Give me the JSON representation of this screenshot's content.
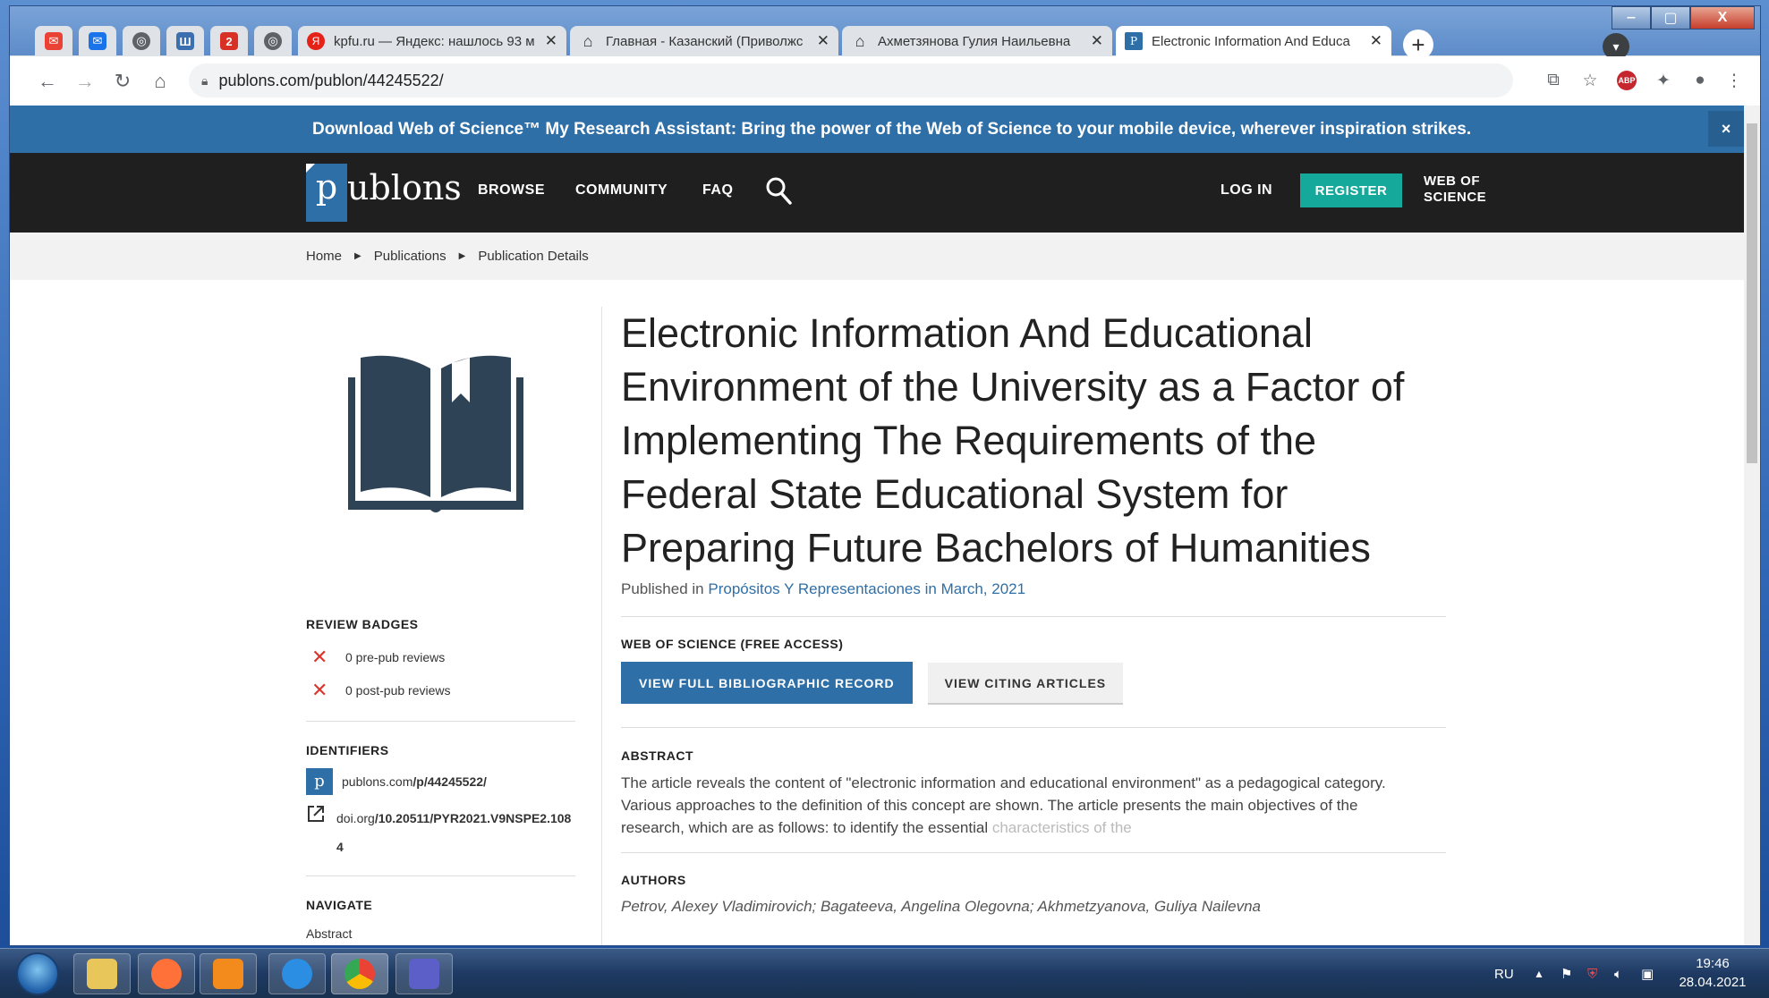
{
  "browser": {
    "pinned_tabs": [
      {
        "icon": "gmail-icon",
        "color": "#ea4335",
        "glyph": "✉"
      },
      {
        "icon": "mail-icon",
        "color": "#1a73e8",
        "glyph": "✉"
      },
      {
        "icon": "globe-icon",
        "color": "#5f6368",
        "glyph": "◎"
      },
      {
        "icon": "bookmark-app-icon",
        "color": "#3c6fb0",
        "glyph": "Ш"
      },
      {
        "icon": "app-icon",
        "color": "#d93025",
        "glyph": "2"
      },
      {
        "icon": "globe-icon",
        "color": "#5f6368",
        "glyph": "◎"
      }
    ],
    "tabs": [
      {
        "title": "kpfu.ru — Яндекс: нашлось 93 м",
        "fav_color": "#e62117",
        "fav_glyph": "Я"
      },
      {
        "title": "Главная - Казанский (Приволжс",
        "fav_color": "#5f6368",
        "fav_glyph": "⌂"
      },
      {
        "title": "Ахметзянова Гулия Наильевна",
        "fav_color": "#5f6368",
        "fav_glyph": "⌂"
      },
      {
        "title": "Electronic Information And Educa",
        "fav_color": "#2f6fa7",
        "fav_glyph": "P",
        "active": true
      }
    ],
    "new_tab_label": "+",
    "url": "publons.com/publon/44245522/",
    "window_buttons": [
      "‒",
      "▢",
      "X"
    ]
  },
  "banner": {
    "text": "Download Web of Science™ My Research Assistant: Bring the power of the Web of Science to your mobile device, wherever inspiration strikes.",
    "close": "×"
  },
  "nav": {
    "logo_p": "p",
    "logo_rest": "ublons",
    "browse": "BROWSE",
    "community": "COMMUNITY",
    "faq": "FAQ",
    "login": "LOG IN",
    "register": "REGISTER",
    "wos_line1": "WEB OF",
    "wos_line2": "SCIENCE"
  },
  "breadcrumb": [
    "Home",
    "Publications",
    "Publication Details"
  ],
  "sidebar": {
    "review_badges_head": "REVIEW BADGES",
    "badges": [
      "0 pre-pub reviews",
      "0 post-pub reviews"
    ],
    "identifiers_head": "IDENTIFIERS",
    "publons_prefix": "publons.com",
    "publons_id": "/p/44245522/",
    "doi_prefix": "doi.org",
    "doi_value": "/10.20511/PYR2021.V9NSPE2.1084",
    "navigate_head": "NAVIGATE",
    "navigate_first": "Abstract"
  },
  "publication": {
    "title": "Electronic Information And Educational Environment of the University as a Factor of Implementing The Requirements of the Federal State Educational System for Preparing Future Bachelors of Humanities",
    "published_prefix": "Published in",
    "journal": "Propósitos Y Representaciones",
    "published_date": "in March, 2021",
    "wos_head": "WEB OF SCIENCE (FREE ACCESS)",
    "btn_full_record": "VIEW FULL BIBLIOGRAPHIC RECORD",
    "btn_citing": "VIEW CITING ARTICLES",
    "abstract_head": "ABSTRACT",
    "abstract_line1": "The article reveals the content of \"electronic information and educational environment\" as a pedagogical category.",
    "abstract_line2": "Various approaches to the definition of this concept are shown. The article presents the main objectives of the",
    "abstract_line3": "research, which are as follows: to identify the essential",
    "abstract_faded": "characteristics of the",
    "authors_head": "AUTHORS",
    "authors": "Petrov, Alexey Vladimirovich;  Bagateeva, Angelina Olegovna;  Akhmetzyanova, Guliya Nailevna"
  },
  "taskbar": {
    "lang": "RU",
    "time": "19:46",
    "date": "28.04.2021",
    "apps": [
      {
        "name": "file-explorer-icon",
        "color": "#e8c65a"
      },
      {
        "name": "firefox-icon",
        "color": "#ff7139"
      },
      {
        "name": "media-player-icon",
        "color": "#f28a1c"
      },
      {
        "name": "internet-explorer-icon",
        "color": "#2b8ee3"
      },
      {
        "name": "chrome-icon",
        "color": "#34a853"
      },
      {
        "name": "teams-icon",
        "color": "#5b5fc7"
      }
    ]
  },
  "colors": {
    "brand_blue": "#2f6fa7",
    "register_teal": "#14a99a",
    "navbar_black": "#1f1f1f",
    "badge_x_red": "#d9362c"
  }
}
